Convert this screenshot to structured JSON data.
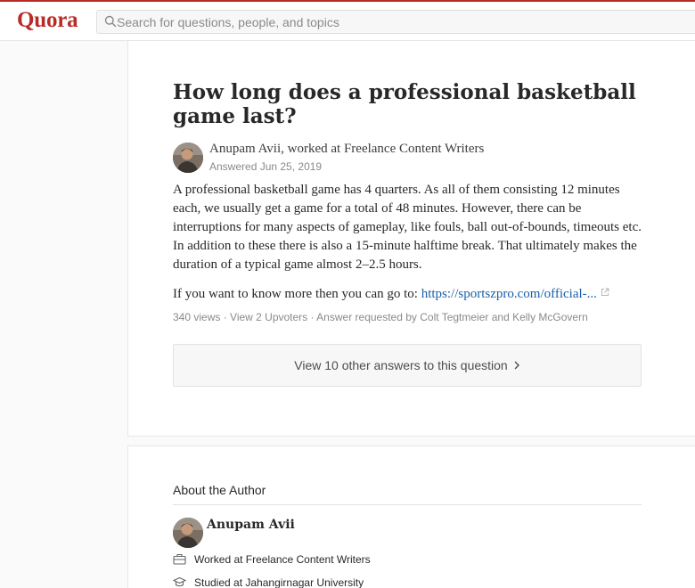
{
  "header": {
    "logo": "Quora",
    "search_placeholder": "Search for questions, people, and topics",
    "brand_color": "#b92b27"
  },
  "question": {
    "title": "How long does a professional basketball game last?"
  },
  "answer": {
    "author_line": "Anupam Avii, worked at Freelance Content Writers",
    "answered_date": "Answered Jun 25, 2019",
    "body": "A professional basketball game has 4 quarters. As all of them consisting 12 minutes each, we usually get a game for a total of 48 minutes. However, there can be interruptions for many aspects of gameplay, like fouls, ball out-of-bounds, timeouts etc. In addition to these there is also a 15-minute halftime break. That ultimately makes the duration of a typical game almost 2–2.5 hours.",
    "link_prefix": "If you want to know more then you can go to: ",
    "link_text": "https://sportszpro.com/official-...",
    "stats": "340 views · View 2 Upvoters · Answer requested by Colt Tegtmeier and Kelly McGovern"
  },
  "more_answers": {
    "label": "View 10 other answers to this question"
  },
  "about_author": {
    "heading": "About the Author",
    "name": "Anupam Avii",
    "work": "Worked at Freelance Content Writers",
    "education": "Studied at Jahangirnagar University"
  }
}
